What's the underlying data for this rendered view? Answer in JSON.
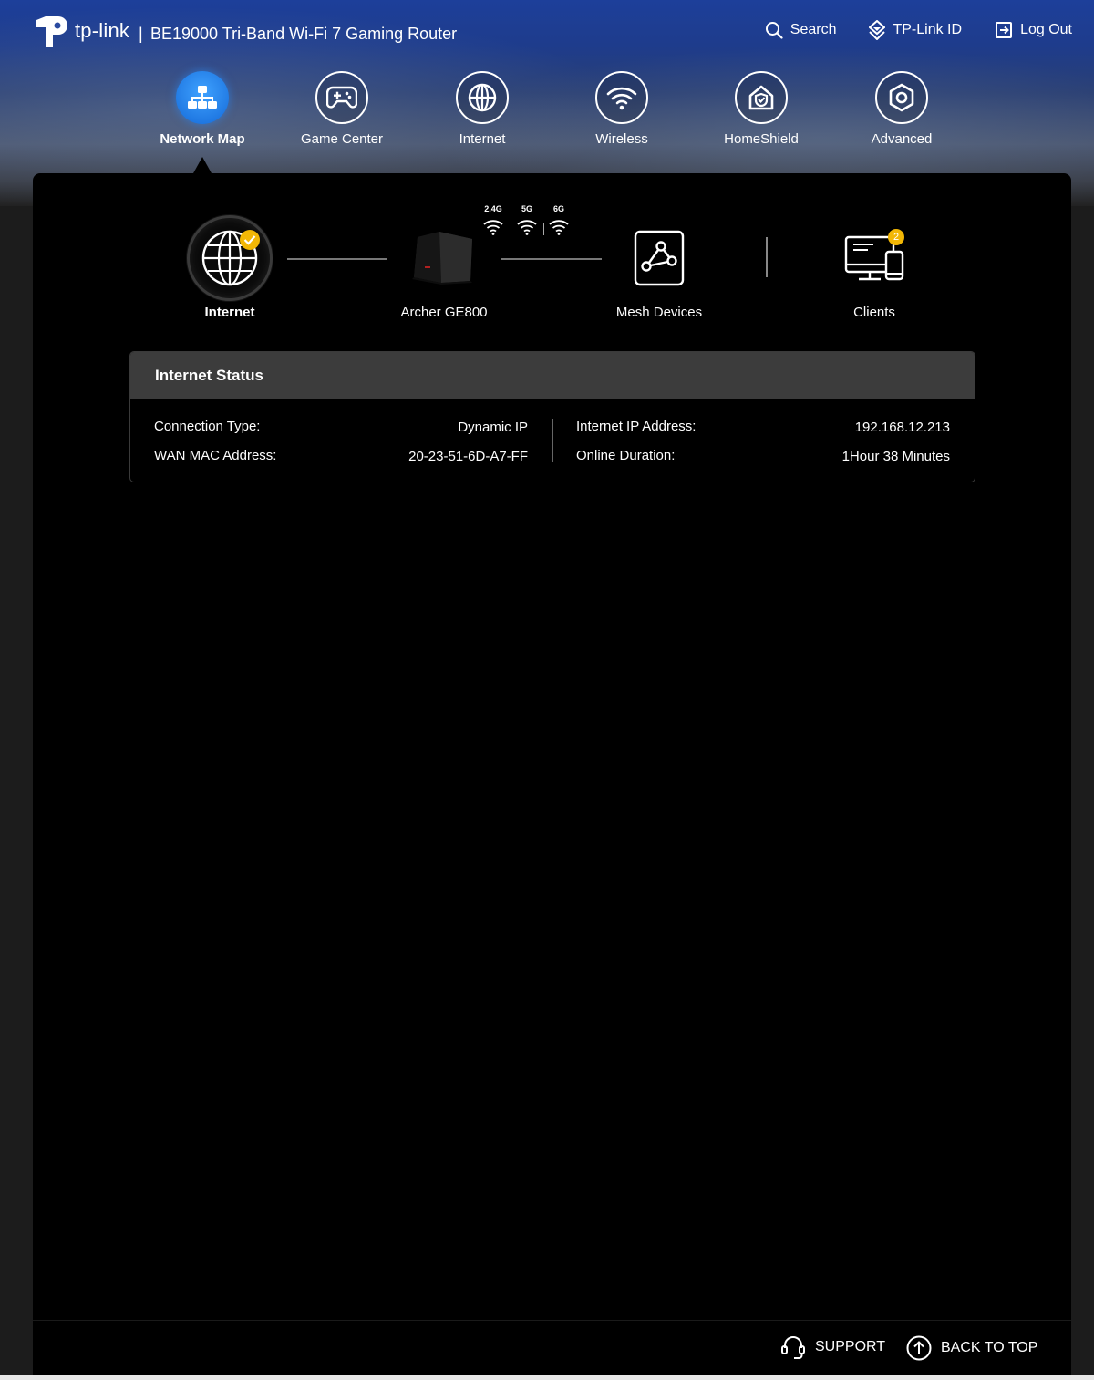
{
  "header": {
    "brand": "tp-link",
    "separator": "|",
    "device_title": "BE19000 Tri-Band Wi-Fi 7 Gaming Router",
    "links": {
      "search": "Search",
      "tplink_id": "TP-Link ID",
      "logout": "Log Out"
    }
  },
  "nav": {
    "items": [
      {
        "label": "Network Map",
        "icon": "network-map-icon",
        "active": true
      },
      {
        "label": "Game Center",
        "icon": "gamepad-icon",
        "active": false
      },
      {
        "label": "Internet",
        "icon": "globe-icon",
        "active": false
      },
      {
        "label": "Wireless",
        "icon": "wifi-icon",
        "active": false
      },
      {
        "label": "HomeShield",
        "icon": "home-shield-icon",
        "active": false
      },
      {
        "label": "Advanced",
        "icon": "gear-icon",
        "active": false
      }
    ]
  },
  "topology": {
    "internet": "Internet",
    "router": "Archer GE800",
    "mesh": "Mesh Devices",
    "clients": "Clients",
    "clients_count": "2",
    "bands": [
      "2.4G",
      "5G",
      "6G"
    ]
  },
  "internet_status": {
    "title": "Internet Status",
    "connection_type_label": "Connection Type:",
    "connection_type_value": "Dynamic IP",
    "wan_mac_label": "WAN MAC Address:",
    "wan_mac_value": "20-23-51-6D-A7-FF",
    "ip_label": "Internet IP Address:",
    "ip_value": "192.168.12.213",
    "duration_label": "Online Duration:",
    "duration_value": "1Hour 38 Minutes"
  },
  "footer": {
    "support": "SUPPORT",
    "back_to_top": "BACK TO TOP"
  },
  "colors": {
    "accent_blue": "#1e7fe8",
    "badge_yellow": "#f2b705",
    "panel_bg": "#000000",
    "status_header_bg": "#3c3c3c"
  }
}
